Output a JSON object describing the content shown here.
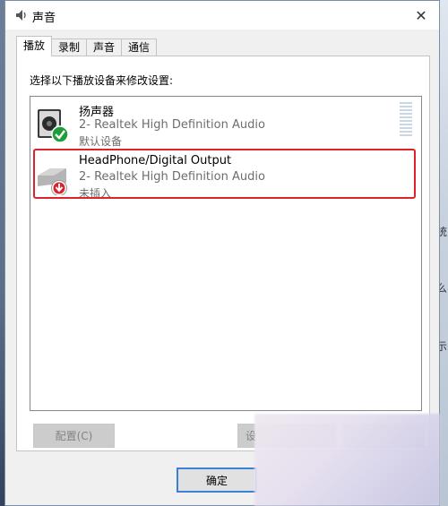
{
  "window": {
    "title": "声音"
  },
  "tabs": [
    {
      "label": "播放",
      "active": true
    },
    {
      "label": "录制",
      "active": false
    },
    {
      "label": "声音",
      "active": false
    },
    {
      "label": "通信",
      "active": false
    }
  ],
  "instruction": "选择以下播放设备来修改设置:",
  "devices": [
    {
      "name": "扬声器",
      "driver": "2- Realtek High Definition Audio",
      "status": "默认设备",
      "icon": "speaker-icon",
      "badge": "checkmark-badge-icon"
    },
    {
      "name": "HeadPhone/Digital Output",
      "driver": "2- Realtek High Definition Audio",
      "status": "未插入",
      "icon": "headphone-device-icon",
      "badge": "unplugged-arrow-badge-icon"
    }
  ],
  "buttons": {
    "configure": "配置(C)",
    "set_default": "设为",
    "ok": "确定"
  },
  "colors": {
    "highlight": "#e0232b",
    "default_badge": "#1e9e3a",
    "unplugged_badge": "#d8262c"
  },
  "background": {
    "right_fragments": [
      "统",
      "么",
      "示"
    ]
  }
}
